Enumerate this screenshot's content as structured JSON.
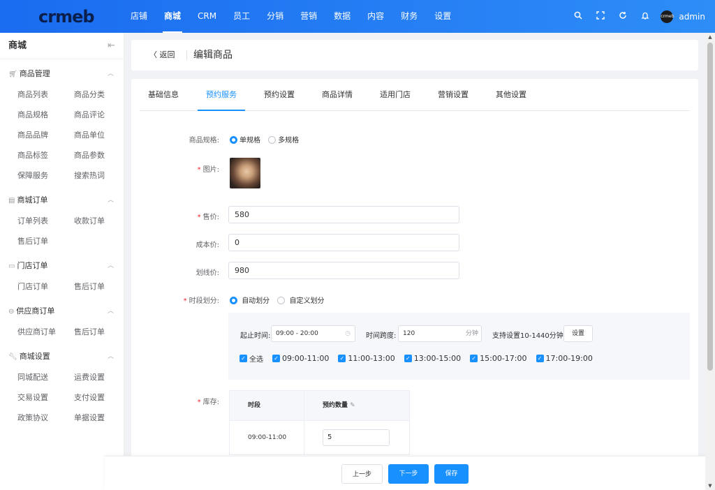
{
  "brand": {
    "logo": "crmeb"
  },
  "topnav": {
    "items": [
      "店铺",
      "商城",
      "CRM",
      "员工",
      "分销",
      "营销",
      "数据",
      "内容",
      "财务",
      "设置"
    ],
    "active_index": 1
  },
  "user": {
    "name": "admin",
    "avatar_text": "crmeb"
  },
  "sidebar": {
    "title": "商城",
    "groups": [
      {
        "label": "商品管理",
        "icon": "cart-icon",
        "items": [
          "商品列表",
          "商品分类",
          "商品规格",
          "商品评论",
          "商品品牌",
          "商品单位",
          "商品标签",
          "商品参数",
          "保障服务",
          "搜索热词"
        ]
      },
      {
        "label": "商城订单",
        "icon": "order-icon",
        "items": [
          "订单列表",
          "收款订单",
          "售后订单"
        ]
      },
      {
        "label": "门店订单",
        "icon": "store-icon",
        "items": [
          "门店订单",
          "售后订单"
        ]
      },
      {
        "label": "供应商订单",
        "icon": "supplier-icon",
        "items": [
          "供应商订单",
          "售后订单"
        ]
      },
      {
        "label": "商城设置",
        "icon": "wrench-icon",
        "items": [
          "同城配送",
          "运费设置",
          "交易设置",
          "支付设置",
          "政策协议",
          "单据设置"
        ]
      }
    ]
  },
  "header": {
    "back_label": "返回",
    "title": "编辑商品"
  },
  "tabs": {
    "items": [
      "基础信息",
      "预约服务",
      "预约设置",
      "商品详情",
      "适用门店",
      "营销设置",
      "其他设置"
    ],
    "active_index": 1
  },
  "form": {
    "spec": {
      "label": "商品规格:",
      "options": [
        "单规格",
        "多规格"
      ],
      "selected": "单规格"
    },
    "image": {
      "label": "图片:"
    },
    "price": {
      "label": "售价:",
      "value": "580"
    },
    "cost": {
      "label": "成本价:",
      "value": "0"
    },
    "original": {
      "label": "划线价:",
      "value": "980"
    },
    "timeslot": {
      "label": "时段划分:",
      "options": [
        "自动划分",
        "自定义划分"
      ],
      "selected": "自动划分"
    },
    "range": {
      "label": "起止时间:",
      "value": "09:00 - 20:00"
    },
    "span": {
      "label": "时间跨度:",
      "value": "120",
      "unit": "分钟"
    },
    "hint": "支持设置10-1440分钟",
    "set_button": "设置",
    "checkboxes": [
      "全选",
      "09:00-11:00",
      "11:00-13:00",
      "13:00-15:00",
      "15:00-17:00",
      "17:00-19:00"
    ],
    "stock": {
      "label": "库存:",
      "headers": [
        "时段",
        "预约数量"
      ],
      "rows": [
        {
          "slot": "09:00-11:00",
          "qty": "5"
        }
      ]
    }
  },
  "footer": {
    "prev": "上一步",
    "next": "下一步",
    "save": "保存"
  },
  "colors": {
    "primary": "#1890ff",
    "topbar": "#1a6cf0",
    "required": "#f5222d"
  }
}
